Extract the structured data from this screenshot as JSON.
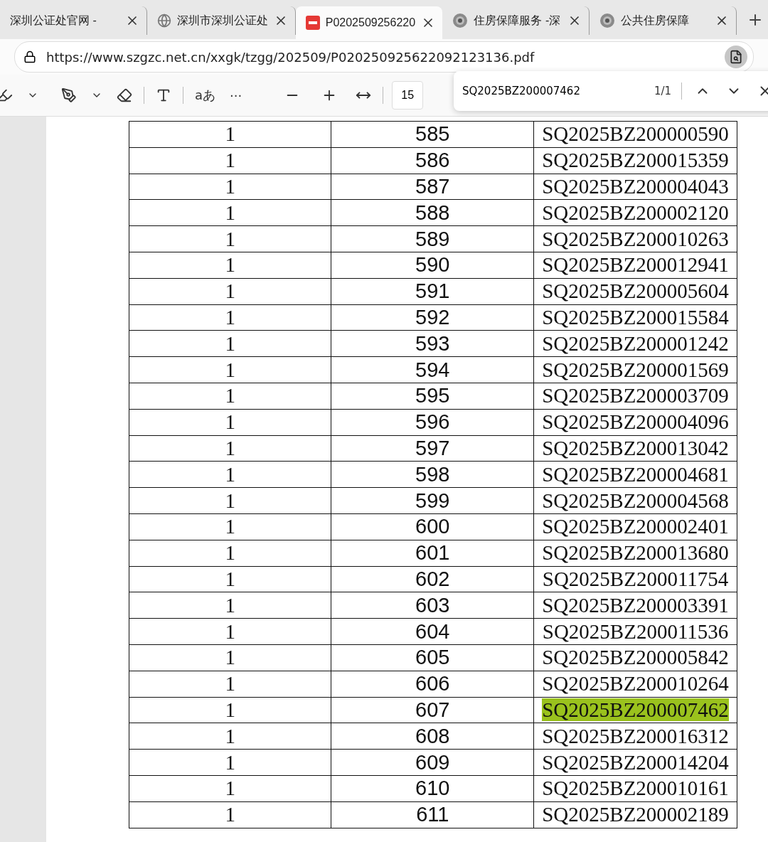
{
  "tabs": [
    {
      "title": "深圳公证处官网 -",
      "kind": "plain",
      "selected": false
    },
    {
      "title": "深圳市深圳公证处",
      "kind": "web",
      "selected": false
    },
    {
      "title": "P0202509256220",
      "kind": "document",
      "selected": true
    },
    {
      "title": "住房保障服务 -深",
      "kind": "site",
      "selected": false
    },
    {
      "title": "公共住房保障",
      "kind": "site",
      "selected": false
    }
  ],
  "address_bar": {
    "url": "https://www.szgzc.net.cn/xxgk/tzgg/202509/P020250925622092123136.pdf"
  },
  "pdf_toolbar": {
    "text_button": "aあ",
    "more": "···",
    "page_number": "15"
  },
  "find_bar": {
    "query": "SQ2025BZ200007462",
    "count": "1/1"
  },
  "table": {
    "rows": [
      {
        "c1": "1",
        "c2": "585",
        "c3": "SQ2025BZ200000590",
        "highlighted": false
      },
      {
        "c1": "1",
        "c2": "586",
        "c3": "SQ2025BZ200015359",
        "highlighted": false
      },
      {
        "c1": "1",
        "c2": "587",
        "c3": "SQ2025BZ200004043",
        "highlighted": false
      },
      {
        "c1": "1",
        "c2": "588",
        "c3": "SQ2025BZ200002120",
        "highlighted": false
      },
      {
        "c1": "1",
        "c2": "589",
        "c3": "SQ2025BZ200010263",
        "highlighted": false
      },
      {
        "c1": "1",
        "c2": "590",
        "c3": "SQ2025BZ200012941",
        "highlighted": false
      },
      {
        "c1": "1",
        "c2": "591",
        "c3": "SQ2025BZ200005604",
        "highlighted": false
      },
      {
        "c1": "1",
        "c2": "592",
        "c3": "SQ2025BZ200015584",
        "highlighted": false
      },
      {
        "c1": "1",
        "c2": "593",
        "c3": "SQ2025BZ200001242",
        "highlighted": false
      },
      {
        "c1": "1",
        "c2": "594",
        "c3": "SQ2025BZ200001569",
        "highlighted": false
      },
      {
        "c1": "1",
        "c2": "595",
        "c3": "SQ2025BZ200003709",
        "highlighted": false
      },
      {
        "c1": "1",
        "c2": "596",
        "c3": "SQ2025BZ200004096",
        "highlighted": false
      },
      {
        "c1": "1",
        "c2": "597",
        "c3": "SQ2025BZ200013042",
        "highlighted": false
      },
      {
        "c1": "1",
        "c2": "598",
        "c3": "SQ2025BZ200004681",
        "highlighted": false
      },
      {
        "c1": "1",
        "c2": "599",
        "c3": "SQ2025BZ200004568",
        "highlighted": false
      },
      {
        "c1": "1",
        "c2": "600",
        "c3": "SQ2025BZ200002401",
        "highlighted": false
      },
      {
        "c1": "1",
        "c2": "601",
        "c3": "SQ2025BZ200013680",
        "highlighted": false
      },
      {
        "c1": "1",
        "c2": "602",
        "c3": "SQ2025BZ200011754",
        "highlighted": false
      },
      {
        "c1": "1",
        "c2": "603",
        "c3": "SQ2025BZ200003391",
        "highlighted": false
      },
      {
        "c1": "1",
        "c2": "604",
        "c3": "SQ2025BZ200011536",
        "highlighted": false
      },
      {
        "c1": "1",
        "c2": "605",
        "c3": "SQ2025BZ200005842",
        "highlighted": false
      },
      {
        "c1": "1",
        "c2": "606",
        "c3": "SQ2025BZ200010264",
        "highlighted": false
      },
      {
        "c1": "1",
        "c2": "607",
        "c3": "SQ2025BZ200007462",
        "highlighted": true
      },
      {
        "c1": "1",
        "c2": "608",
        "c3": "SQ2025BZ200016312",
        "highlighted": false
      },
      {
        "c1": "1",
        "c2": "609",
        "c3": "SQ2025BZ200014204",
        "highlighted": false
      },
      {
        "c1": "1",
        "c2": "610",
        "c3": "SQ2025BZ200010161",
        "highlighted": false
      },
      {
        "c1": "1",
        "c2": "611",
        "c3": "SQ2025BZ200002189",
        "highlighted": false
      }
    ]
  }
}
